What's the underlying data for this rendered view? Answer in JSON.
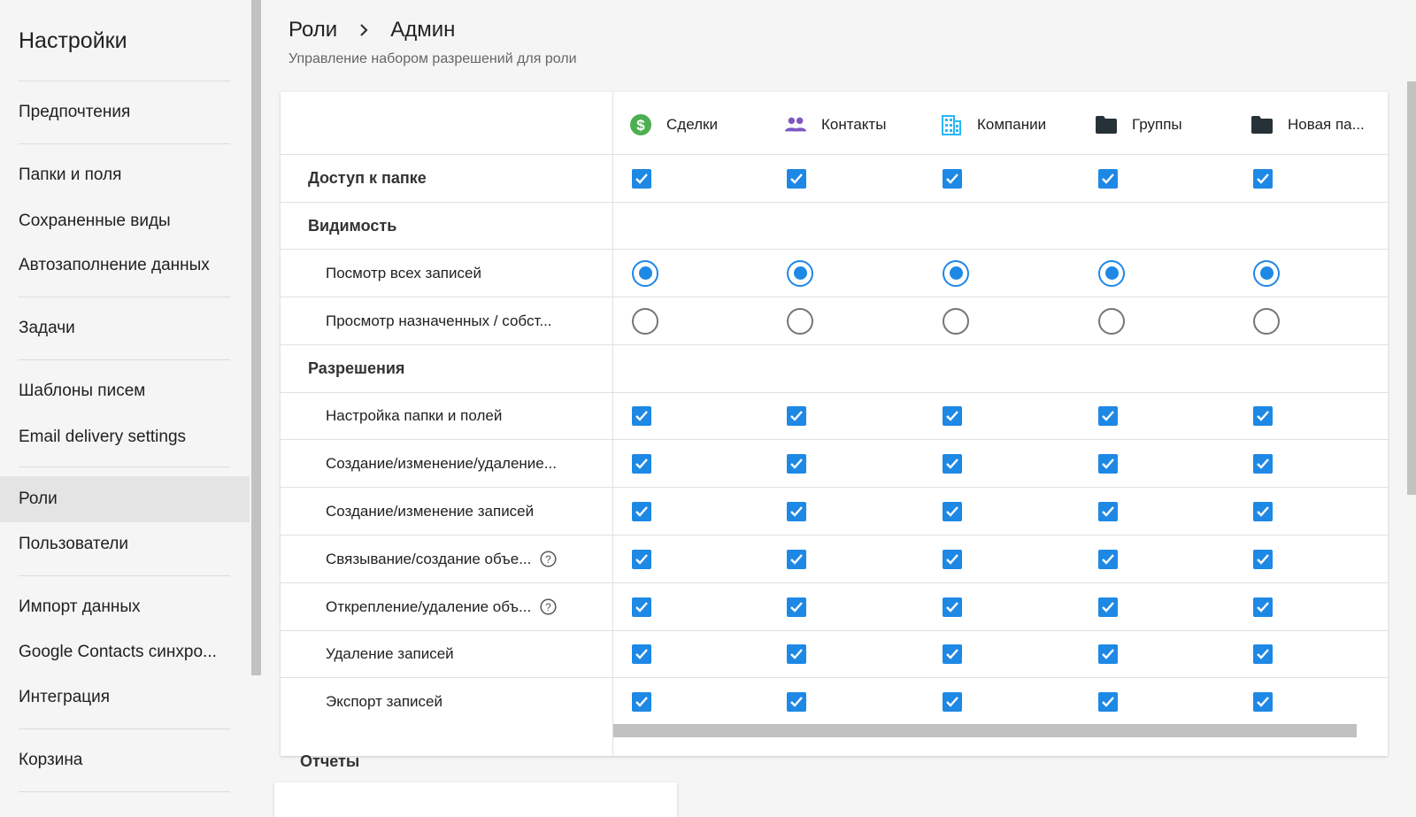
{
  "sidebar": {
    "title": "Настройки",
    "items": [
      {
        "id": "preferences",
        "label": "Предпочтения"
      },
      {
        "id": "folders-fields",
        "label": "Папки и поля"
      },
      {
        "id": "saved-views",
        "label": "Сохраненные виды"
      },
      {
        "id": "autofill",
        "label": "Автозаполнение данных"
      },
      {
        "id": "tasks",
        "label": "Задачи"
      },
      {
        "id": "email-templates",
        "label": "Шаблоны писем"
      },
      {
        "id": "email-delivery",
        "label": "Email delivery settings"
      },
      {
        "id": "roles",
        "label": "Роли",
        "active": true
      },
      {
        "id": "users",
        "label": "Пользователи"
      },
      {
        "id": "import",
        "label": "Импорт данных"
      },
      {
        "id": "google-contacts",
        "label": "Google Contacts синхро..."
      },
      {
        "id": "integration",
        "label": "Интеграция"
      },
      {
        "id": "trash",
        "label": "Корзина"
      }
    ]
  },
  "header": {
    "breadcrumb_root": "Роли",
    "breadcrumb_current": "Админ",
    "subtitle": "Управление набором разрешений для роли"
  },
  "columns": [
    {
      "label": "Сделки",
      "icon": "dollar-circle-icon",
      "color": "#4caf50"
    },
    {
      "label": "Контакты",
      "icon": "people-icon",
      "color": "#7e57c2"
    },
    {
      "label": "Компании",
      "icon": "building-icon",
      "color": "#29b6f6"
    },
    {
      "label": "Группы",
      "icon": "folder-icon",
      "color": "#263238"
    },
    {
      "label": "Новая па...",
      "icon": "folder-icon",
      "color": "#263238"
    }
  ],
  "rows": {
    "folder_access": {
      "label": "Доступ к папке",
      "values": [
        true,
        true,
        true,
        true,
        true
      ]
    },
    "visibility_section": {
      "label": "Видимость"
    },
    "view_all": {
      "label": "Посмотр всех записей",
      "values": [
        true,
        true,
        true,
        true,
        true
      ]
    },
    "view_assigned": {
      "label": "Просмотр назначенных / собст...",
      "values": [
        false,
        false,
        false,
        false,
        false
      ]
    },
    "permissions_section": {
      "label": "Разрешения"
    },
    "configure": {
      "label": "Настройка папки и полей",
      "values": [
        true,
        true,
        true,
        true,
        true
      ]
    },
    "create_edit_delete": {
      "label": "Создание/изменение/удаление...",
      "values": [
        true,
        true,
        true,
        true,
        true
      ]
    },
    "create_edit": {
      "label": "Создание/изменение записей",
      "values": [
        true,
        true,
        true,
        true,
        true
      ]
    },
    "link_create": {
      "label": "Связывание/создание объе...",
      "help": true,
      "values": [
        true,
        true,
        true,
        true,
        true
      ]
    },
    "unlink_delete": {
      "label": "Открепление/удаление объ...",
      "help": true,
      "values": [
        true,
        true,
        true,
        true,
        true
      ]
    },
    "delete": {
      "label": "Удаление записей",
      "values": [
        true,
        true,
        true,
        true,
        true
      ]
    },
    "export": {
      "label": "Экспорт записей",
      "values": [
        true,
        true,
        true,
        true,
        true
      ]
    }
  },
  "reports": {
    "title": "Отчеты"
  },
  "colors": {
    "accent": "#1e88e5",
    "radio_off": "#757575",
    "active_item_bg": "#e4e4e4"
  }
}
